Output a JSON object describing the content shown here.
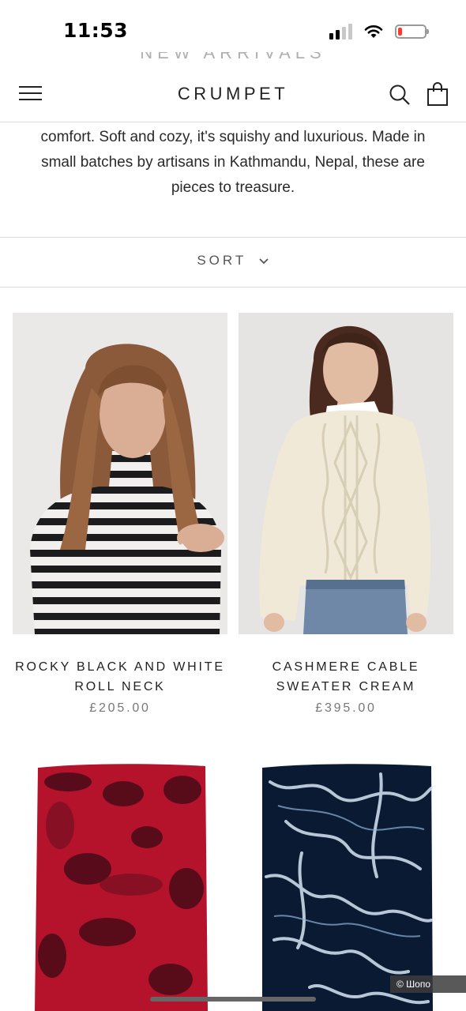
{
  "status_bar": {
    "time": "11:53",
    "signal_icon": "cellular-signal-icon",
    "wifi_icon": "wifi-icon",
    "battery_icon": "battery-low-icon",
    "battery_color": "#ff3b30"
  },
  "header": {
    "brand": "CRUMPET",
    "menu_icon": "hamburger-menu-icon",
    "search_icon": "search-icon",
    "cart_icon": "shopping-bag-icon",
    "faded_heading": "NEW ARRIVALS"
  },
  "description": "comfort. Soft and cozy, it's squishy and luxurious. Made in small batches by artisans in Kathmandu, Nepal, these are pieces to treasure.",
  "sort": {
    "label": "SORT",
    "icon": "chevron-down-icon"
  },
  "products": [
    {
      "title": "ROCKY BLACK AND WHITE ROLL NECK",
      "price": "£205.00"
    },
    {
      "title": "CASHMERE CABLE SWEATER CREAM",
      "price": "£395.00"
    },
    {
      "title": "",
      "price": ""
    },
    {
      "title": "",
      "price": ""
    }
  ],
  "watermark": "© Шопо",
  "colors": {
    "text": "#222222",
    "price": "#777777",
    "divider": "#d9d9d9",
    "red_tiedye": "#b5122c",
    "navy_tiedye": "#0b1a33"
  }
}
